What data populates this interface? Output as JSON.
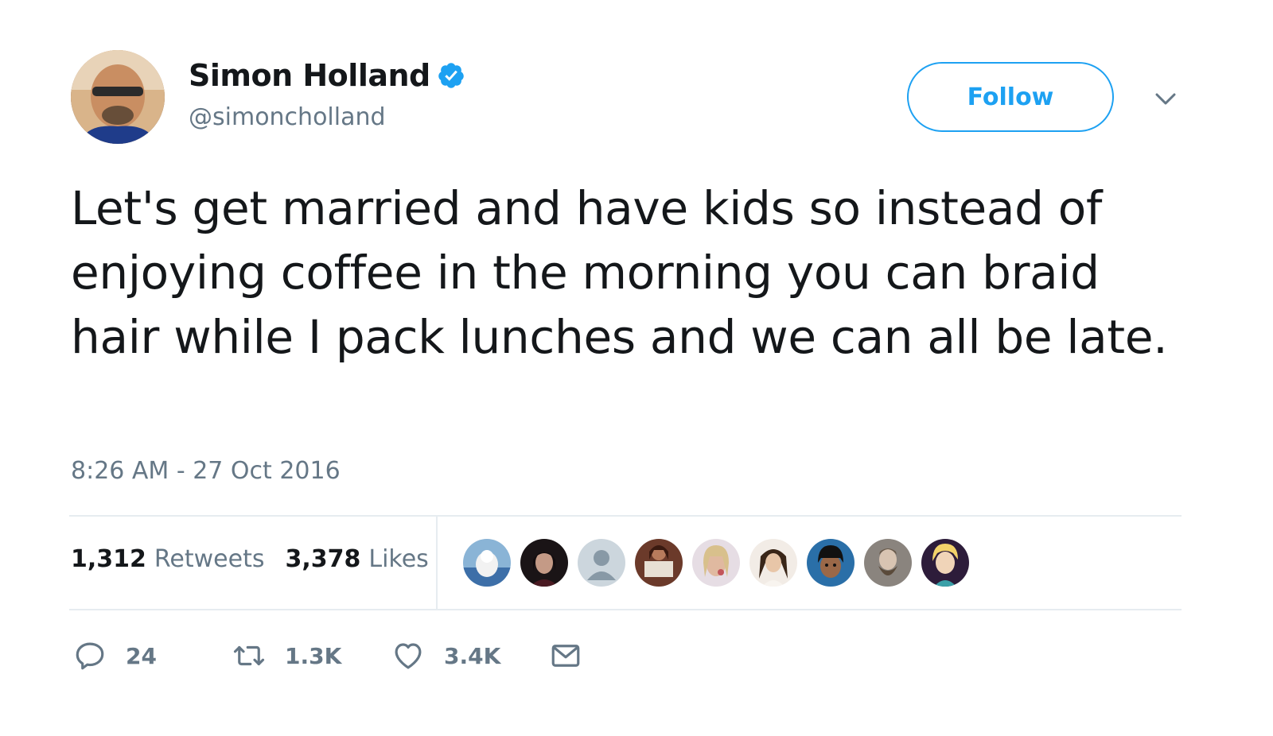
{
  "author": {
    "display_name": "Simon Holland",
    "handle": "@simoncholland",
    "verified": true
  },
  "follow_label": "Follow",
  "tweet": {
    "text": "Let's get married and have kids so instead of enjoying coffee in the morning you can braid hair while I pack lunches and we can all be late.",
    "timestamp": "8:26 AM - 27 Oct 2016"
  },
  "stats": {
    "retweets_count": "1,312",
    "retweets_label": "Retweets",
    "likes_count": "3,378",
    "likes_label": "Likes"
  },
  "actions": {
    "reply_count": "24",
    "retweet_count": "1.3K",
    "like_count": "3.4K"
  },
  "colors": {
    "accent": "#1da1f2",
    "text": "#14171a",
    "secondary": "#657786",
    "divider": "#e6ecf0"
  },
  "icons": [
    "verified-badge-icon",
    "chevron-down-icon",
    "reply-icon",
    "retweet-icon",
    "heart-icon",
    "envelope-icon"
  ]
}
